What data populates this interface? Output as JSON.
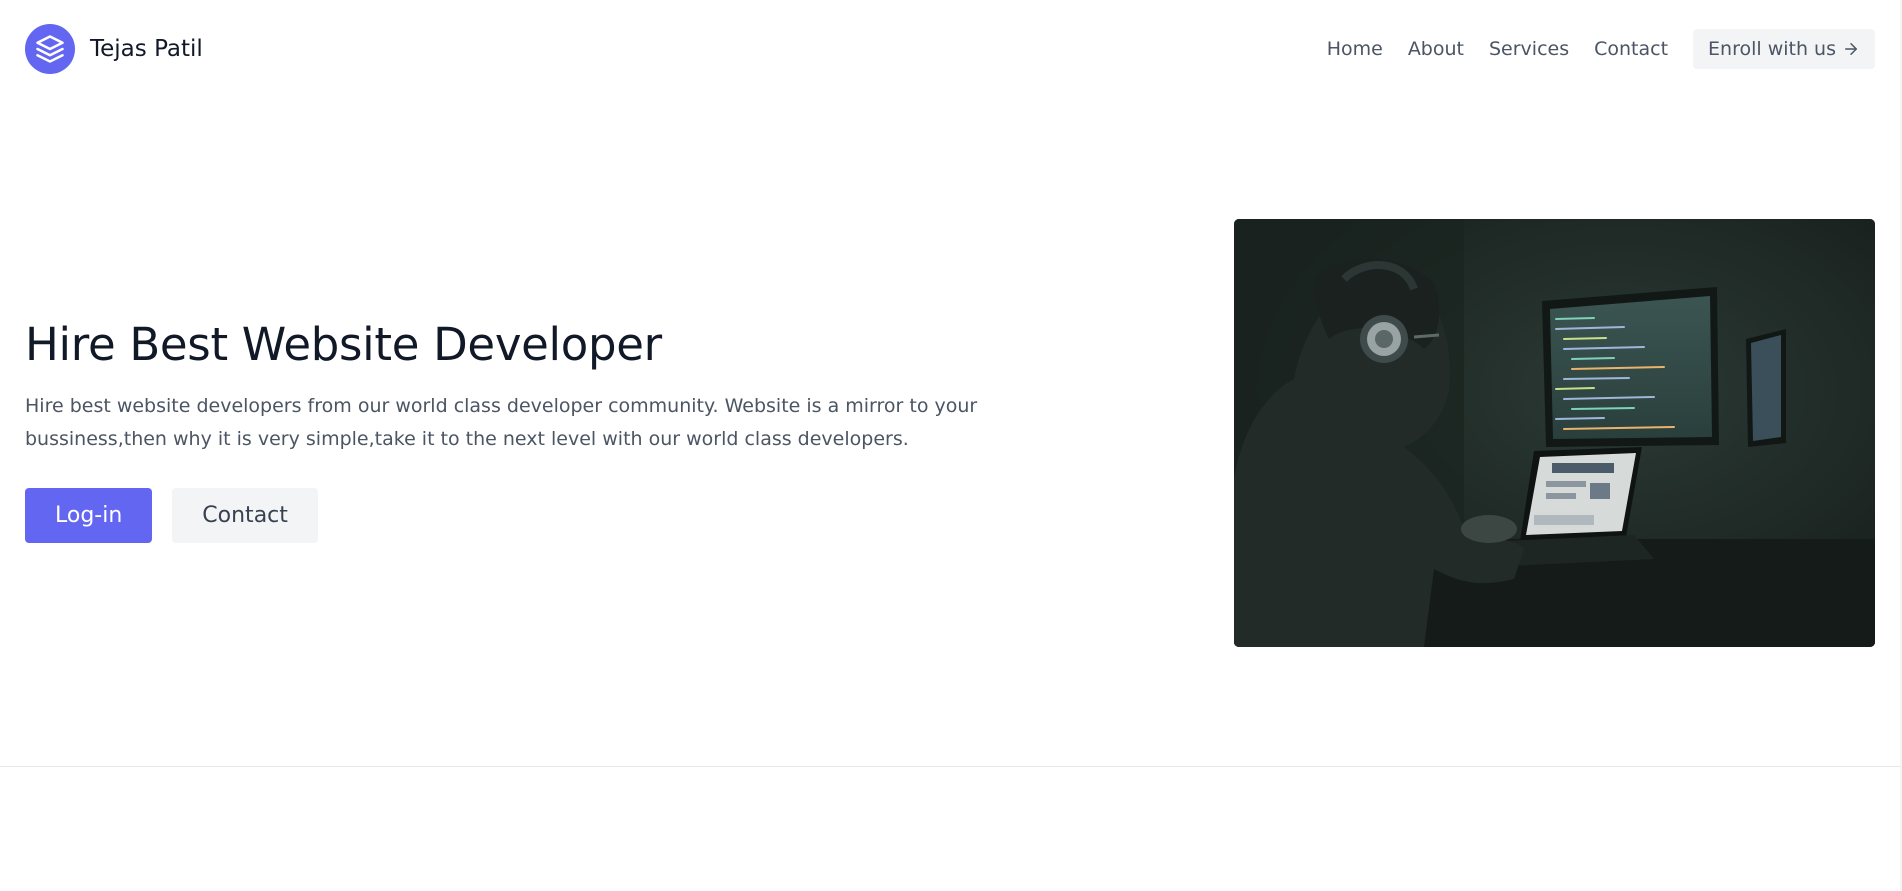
{
  "header": {
    "brand": "Tejas Patil",
    "nav": [
      "Home",
      "About",
      "Services",
      "Contact"
    ],
    "enroll_label": "Enroll with us"
  },
  "hero": {
    "title": "Hire Best Website Developer",
    "description": "Hire best website developers from our world class developer community. Website is a mirror to your bussiness,then why it is very simple,take it to the next level with our world class developers.",
    "login_label": "Log-in",
    "contact_label": "Contact"
  },
  "colors": {
    "accent": "#6366f1",
    "text_dark": "#111827",
    "text_muted": "#4b5563",
    "button_gray": "#f3f4f6"
  },
  "icons": {
    "logo": "stack-layers-icon",
    "enroll_arrow": "arrow-right-icon"
  }
}
